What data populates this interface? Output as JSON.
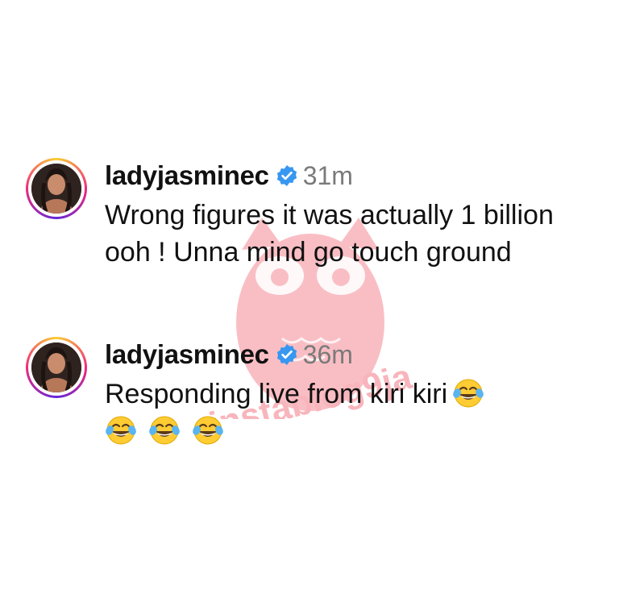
{
  "comments": [
    {
      "username": "ladyjasminec",
      "time": "31m",
      "text": "Wrong figures it was actually 1 billion ooh ! Unna mind go touch ground"
    },
    {
      "username": "ladyjasminec",
      "time": "36m",
      "text": "Responding live from kiri kiri",
      "emoji": "😂"
    }
  ],
  "watermark": {
    "text": "instablog9ja"
  },
  "colors": {
    "verified": "#3897f0",
    "watermark": "#f47a86",
    "timestamp": "#7a7a7a"
  }
}
